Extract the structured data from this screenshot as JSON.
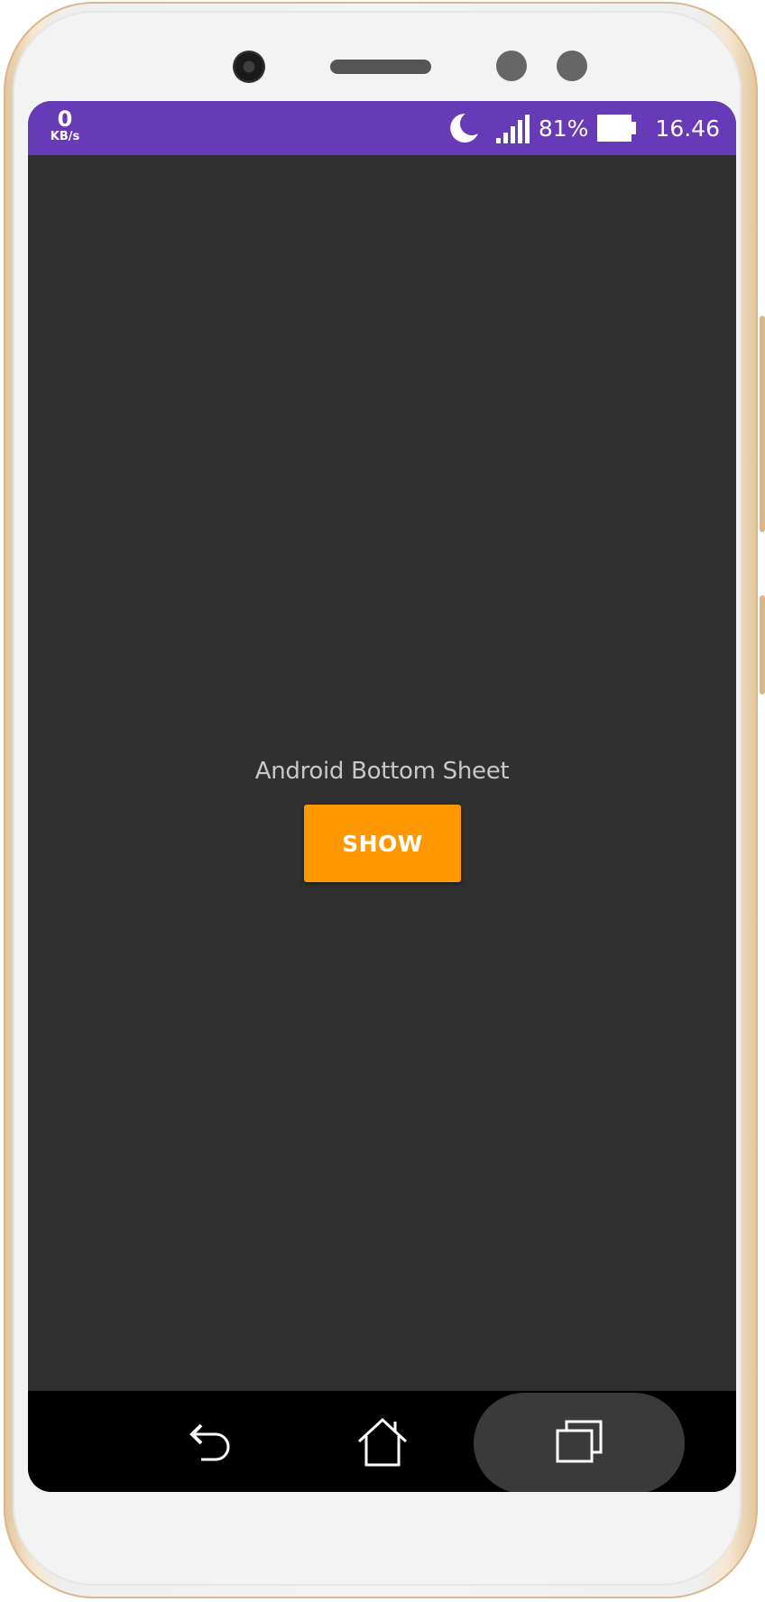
{
  "status_bar": {
    "net_speed_value": "0",
    "net_speed_unit": "KB/s",
    "battery_percent": "81%",
    "time": "16.46",
    "icons": [
      "moon-icon",
      "signal-icon",
      "battery-icon"
    ],
    "color": "#673ab7"
  },
  "main": {
    "title": "Android Bottom Sheet",
    "show_button_label": "SHOW",
    "button_color": "#ff9800",
    "background_color": "#303030"
  },
  "nav_bar": {
    "icons": [
      "back-icon",
      "home-icon",
      "recents-icon"
    ]
  }
}
